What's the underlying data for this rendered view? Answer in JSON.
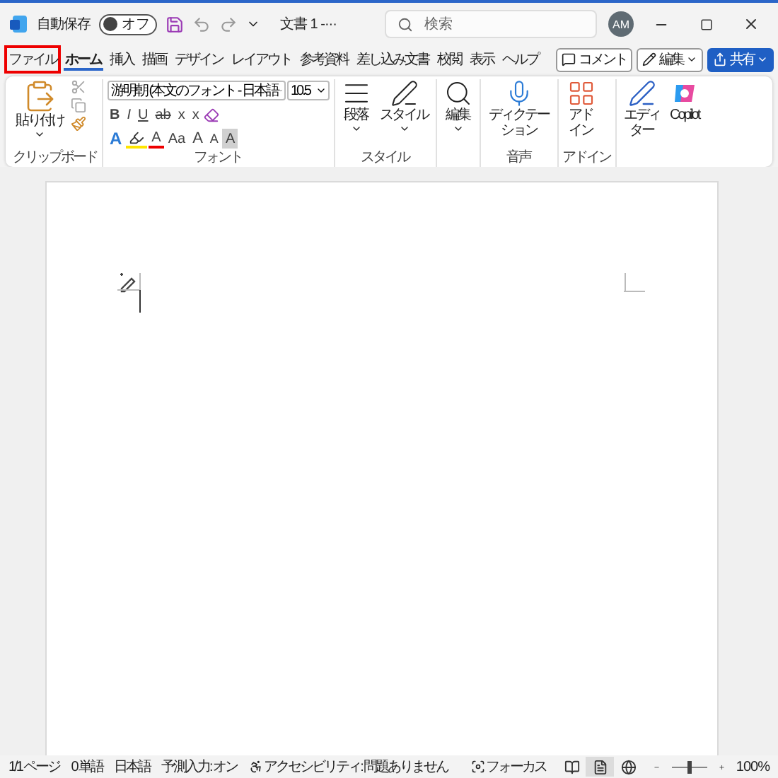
{
  "title_bar": {
    "autosave_label": "自動保存",
    "autosave": {
      "label": "オフ",
      "on": false
    },
    "document_title": "文書 1 -···",
    "search": {
      "placeholder": "検索"
    },
    "avatar": "AM"
  },
  "tabs": [
    {
      "label": "ファイル",
      "selected": false,
      "highlighted": true
    },
    {
      "label": "ホーム",
      "selected": true,
      "highlighted": false
    },
    {
      "label": "挿入",
      "selected": false,
      "highlighted": false
    },
    {
      "label": "描画",
      "selected": false,
      "highlighted": false
    },
    {
      "label": "デザイン",
      "selected": false,
      "highlighted": false
    },
    {
      "label": "レイアウト",
      "selected": false,
      "highlighted": false
    },
    {
      "label": "参考資料",
      "selected": false,
      "highlighted": false
    },
    {
      "label": "差し込み文書",
      "selected": false,
      "highlighted": false
    },
    {
      "label": "校閲",
      "selected": false,
      "highlighted": false
    },
    {
      "label": "表示",
      "selected": false,
      "highlighted": false
    },
    {
      "label": "ヘルプ",
      "selected": false,
      "highlighted": false
    }
  ],
  "tab_actions": [
    {
      "kind": "comment",
      "label": "コメント"
    },
    {
      "kind": "edit",
      "label": "編集"
    },
    {
      "kind": "share",
      "label": "共有"
    }
  ],
  "ribbon": {
    "clipboard": {
      "paste": "貼り付け",
      "label": "クリップボード"
    },
    "font": {
      "font_name": "游明朝 (本文のフォント - 日本語",
      "font_size": "10.5",
      "label": "フォント",
      "row1": [
        {
          "kind": "bold",
          "text": "B"
        },
        {
          "kind": "italic",
          "text": "I"
        },
        {
          "kind": "underline",
          "text": "U"
        },
        {
          "kind": "strike",
          "text": "ab"
        },
        {
          "kind": "subscript",
          "text": "x"
        },
        {
          "kind": "superscript",
          "text": "x"
        }
      ],
      "row2": [
        {
          "kind": "effect",
          "text": "A"
        },
        {
          "kind": "highlight"
        },
        {
          "kind": "color",
          "text": "A"
        },
        {
          "kind": "case",
          "text": "Aa"
        },
        {
          "kind": "grow",
          "text": "A"
        },
        {
          "kind": "shrink",
          "text": "A"
        },
        {
          "kind": "shade",
          "text": "A"
        }
      ]
    },
    "styles": {
      "paragraph": "段落",
      "styles": "スタイル",
      "label": "スタイル"
    },
    "editing": "編集",
    "voice": {
      "dictate": "ディクテーション",
      "label": "音声"
    },
    "addins": {
      "addins": "アドイン",
      "label": "アドイン"
    },
    "editor": "エディター",
    "copilot": "Copilot"
  },
  "status_bar": {
    "items": [
      "1/1 ページ",
      "0 単語",
      "日本語",
      "予測入力: オン"
    ],
    "accessibility": "アクセシビリティ: 問題ありません",
    "focus": "フォーカス",
    "views": [
      {
        "kind": "read",
        "selected": false
      },
      {
        "kind": "print",
        "selected": true
      },
      {
        "kind": "web",
        "selected": false
      }
    ],
    "zoom": {
      "level": 0.5,
      "label": "100%"
    }
  }
}
